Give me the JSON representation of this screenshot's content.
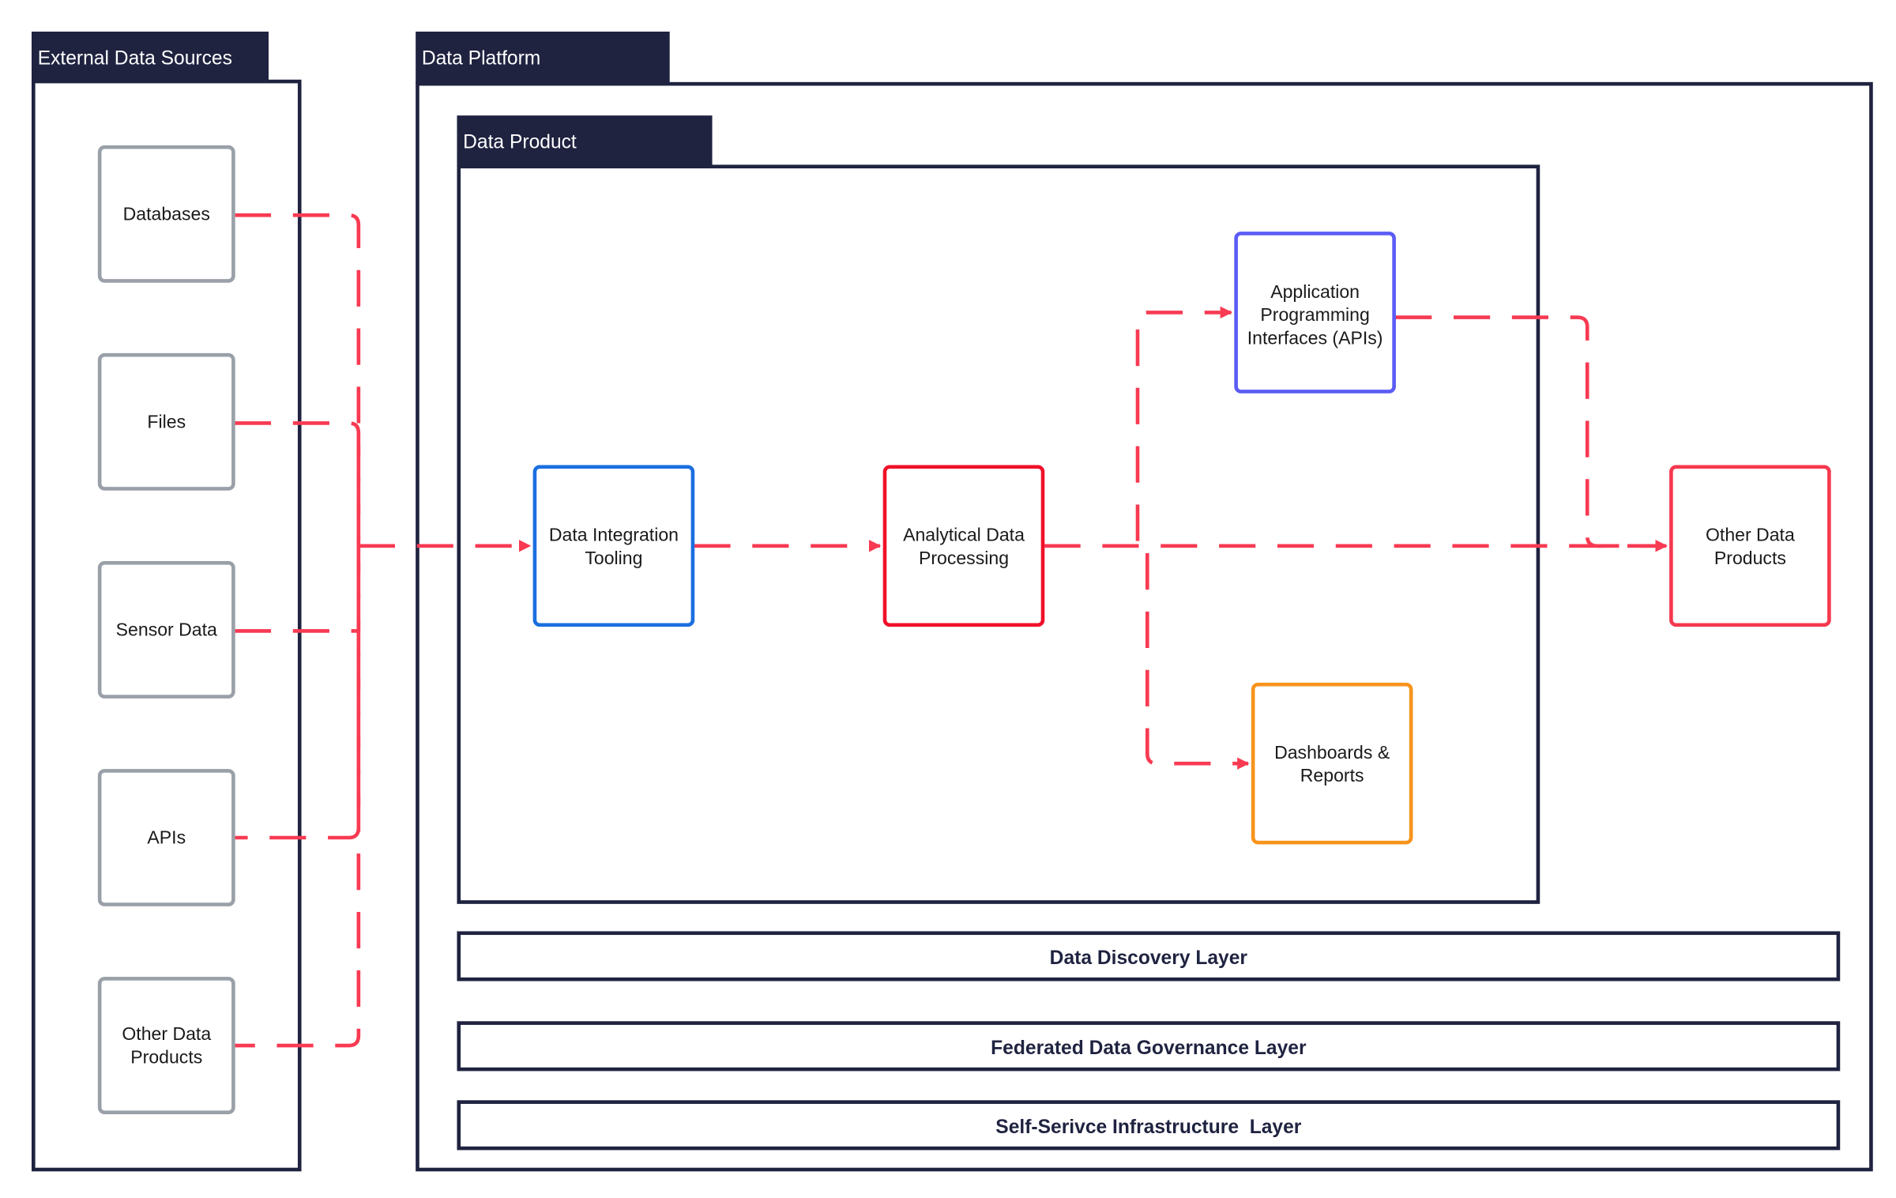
{
  "containers": {
    "external": "External Data Sources",
    "platform": "Data Platform",
    "product": "Data Product"
  },
  "sources": [
    [
      "Databases"
    ],
    [
      "Files"
    ],
    [
      "Sensor Data"
    ],
    [
      "APIs"
    ],
    [
      "Other Data",
      "Products"
    ]
  ],
  "nodes": {
    "integration": [
      "Data Integration",
      "Tooling"
    ],
    "analytical": [
      "Analytical Data",
      "Processing"
    ],
    "apis": [
      "Application",
      "Programming",
      "Interfaces (APIs)"
    ],
    "dashboards": [
      "Dashboards &",
      "Reports"
    ],
    "other": [
      "Other Data",
      "Products"
    ]
  },
  "layers": [
    "Data Discovery Layer",
    "Federated Data Governance Layer",
    "Self-Serivce Infrastructure  Layer"
  ],
  "colors": {
    "dark": "#1f2340",
    "source_border": "#9aa0a8",
    "integration": "#1a6fdf",
    "analytical": "#f0112a",
    "apis": "#5b5bf5",
    "dashboards": "#f7941d",
    "other": "#f5394f",
    "flow": "#f83a52"
  }
}
